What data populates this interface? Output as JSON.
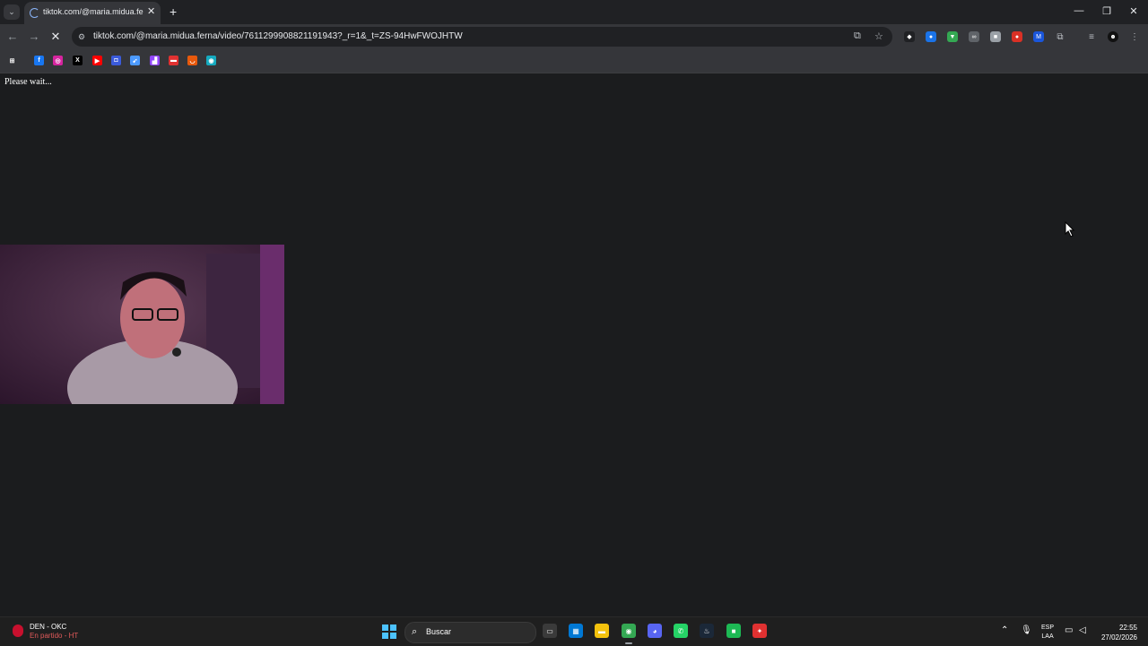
{
  "browser": {
    "tab": {
      "title": "tiktok.com/@maria.midua.ferna",
      "close": "✕"
    },
    "new_tab": "+",
    "window_controls": {
      "minimize": "—",
      "restore": "❐",
      "close": "✕"
    },
    "nav": {
      "back": "←",
      "forward": "→",
      "stop": "✕"
    },
    "url": "tiktok.com/@maria.midua.ferna/video/7611299908821191943?_r=1&_t=ZS-94HwFWOJHTW",
    "extensions": [
      {
        "name": "diamond-extension-icon",
        "color": "#202124",
        "glyph": "◆"
      },
      {
        "name": "blue-extension-icon",
        "color": "#1a73e8",
        "glyph": "●"
      },
      {
        "name": "shield-extension-icon",
        "color": "#34a853",
        "glyph": "▼"
      },
      {
        "name": "glasses-extension-icon",
        "color": "#5f6368",
        "glyph": "∞"
      },
      {
        "name": "square-extension-icon",
        "color": "#9aa0a6",
        "glyph": "■"
      },
      {
        "name": "red-extension-icon",
        "color": "#d93025",
        "glyph": "●"
      },
      {
        "name": "m-extension-icon",
        "color": "#1a56db",
        "glyph": "M"
      }
    ]
  },
  "bookmarks": [
    {
      "name": "apps-bookmark-icon",
      "color": "#35363a",
      "glyph": "⊞"
    },
    {
      "name": "facebook-bookmark-icon",
      "color": "#1877f2",
      "glyph": "f"
    },
    {
      "name": "instagram-bookmark-icon",
      "color": "#d6249f",
      "glyph": "◎"
    },
    {
      "name": "x-bookmark-icon",
      "color": "#000000",
      "glyph": "X"
    },
    {
      "name": "youtube-bookmark-icon",
      "color": "#ff0000",
      "glyph": "▶"
    },
    {
      "name": "bookmark-blue-icon",
      "color": "#3b5bdb",
      "glyph": "◘"
    },
    {
      "name": "bookmark-arrow-icon",
      "color": "#4c9aff",
      "glyph": "➹"
    },
    {
      "name": "twitch-bookmark-icon",
      "color": "#9146ff",
      "glyph": "▟"
    },
    {
      "name": "bookmark-red-icon",
      "color": "#e03131",
      "glyph": "▬"
    },
    {
      "name": "bookmark-orange-icon",
      "color": "#e8590c",
      "glyph": "◡"
    },
    {
      "name": "bookmark-teal-icon",
      "color": "#15aabf",
      "glyph": "◉"
    }
  ],
  "page": {
    "status_text": "Please wait..."
  },
  "taskbar": {
    "widget": {
      "title": "DEN - OKC",
      "subtitle": "En partido - HT"
    },
    "search_placeholder": "Buscar",
    "apps": [
      {
        "name": "task-view-icon",
        "color": "#3a3a3a",
        "glyph": "▭"
      },
      {
        "name": "store-icon",
        "color": "#0078d4",
        "glyph": "▦"
      },
      {
        "name": "file-explorer-icon",
        "color": "#f4c20d",
        "glyph": "▬"
      },
      {
        "name": "chrome-icon",
        "color": "#34a853",
        "glyph": "◉"
      },
      {
        "name": "discord-icon",
        "color": "#5865f2",
        "glyph": "◕"
      },
      {
        "name": "whatsapp-icon",
        "color": "#25d366",
        "glyph": "✆"
      },
      {
        "name": "steam-icon",
        "color": "#1b2838",
        "glyph": "♨"
      },
      {
        "name": "app-green-icon",
        "color": "#1db954",
        "glyph": "■"
      },
      {
        "name": "app-red-icon",
        "color": "#e03131",
        "glyph": "✦"
      }
    ],
    "lang": {
      "line1": "ESP",
      "line2": "LAA"
    },
    "clock": {
      "time": "22:55",
      "date": "27/02/2026"
    }
  }
}
